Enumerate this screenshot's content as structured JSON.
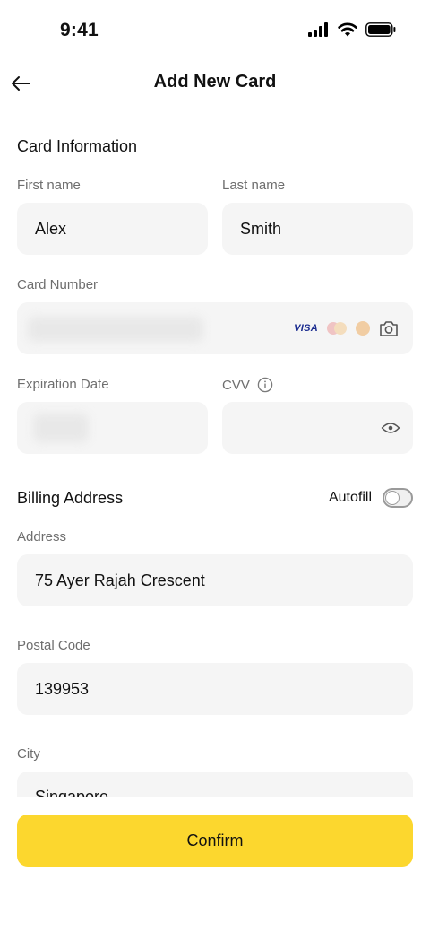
{
  "status_bar": {
    "time": "9:41"
  },
  "nav": {
    "title": "Add New Card"
  },
  "card_info": {
    "section_title": "Card Information",
    "first_name": {
      "label": "First name",
      "value": "Alex"
    },
    "last_name": {
      "label": "Last name",
      "value": "Smith"
    },
    "card_number": {
      "label": "Card Number",
      "brands": [
        "visa-logo",
        "mastercard-logo",
        "discover-logo"
      ],
      "visa_text": "VISA"
    },
    "expiration": {
      "label": "Expiration Date"
    },
    "cvv": {
      "label": "CVV"
    }
  },
  "billing": {
    "section_title": "Billing Address",
    "autofill_label": "Autofill",
    "autofill_on": false,
    "address": {
      "label": "Address",
      "value": "75 Ayer Rajah Crescent"
    },
    "postal_code": {
      "label": "Postal Code",
      "value": "139953"
    },
    "city": {
      "label": "City",
      "value": "Singapore"
    }
  },
  "confirm_label": "Confirm",
  "colors": {
    "accent": "#fcd72e",
    "field_bg": "#f5f5f5",
    "label": "#6e6e6e"
  }
}
